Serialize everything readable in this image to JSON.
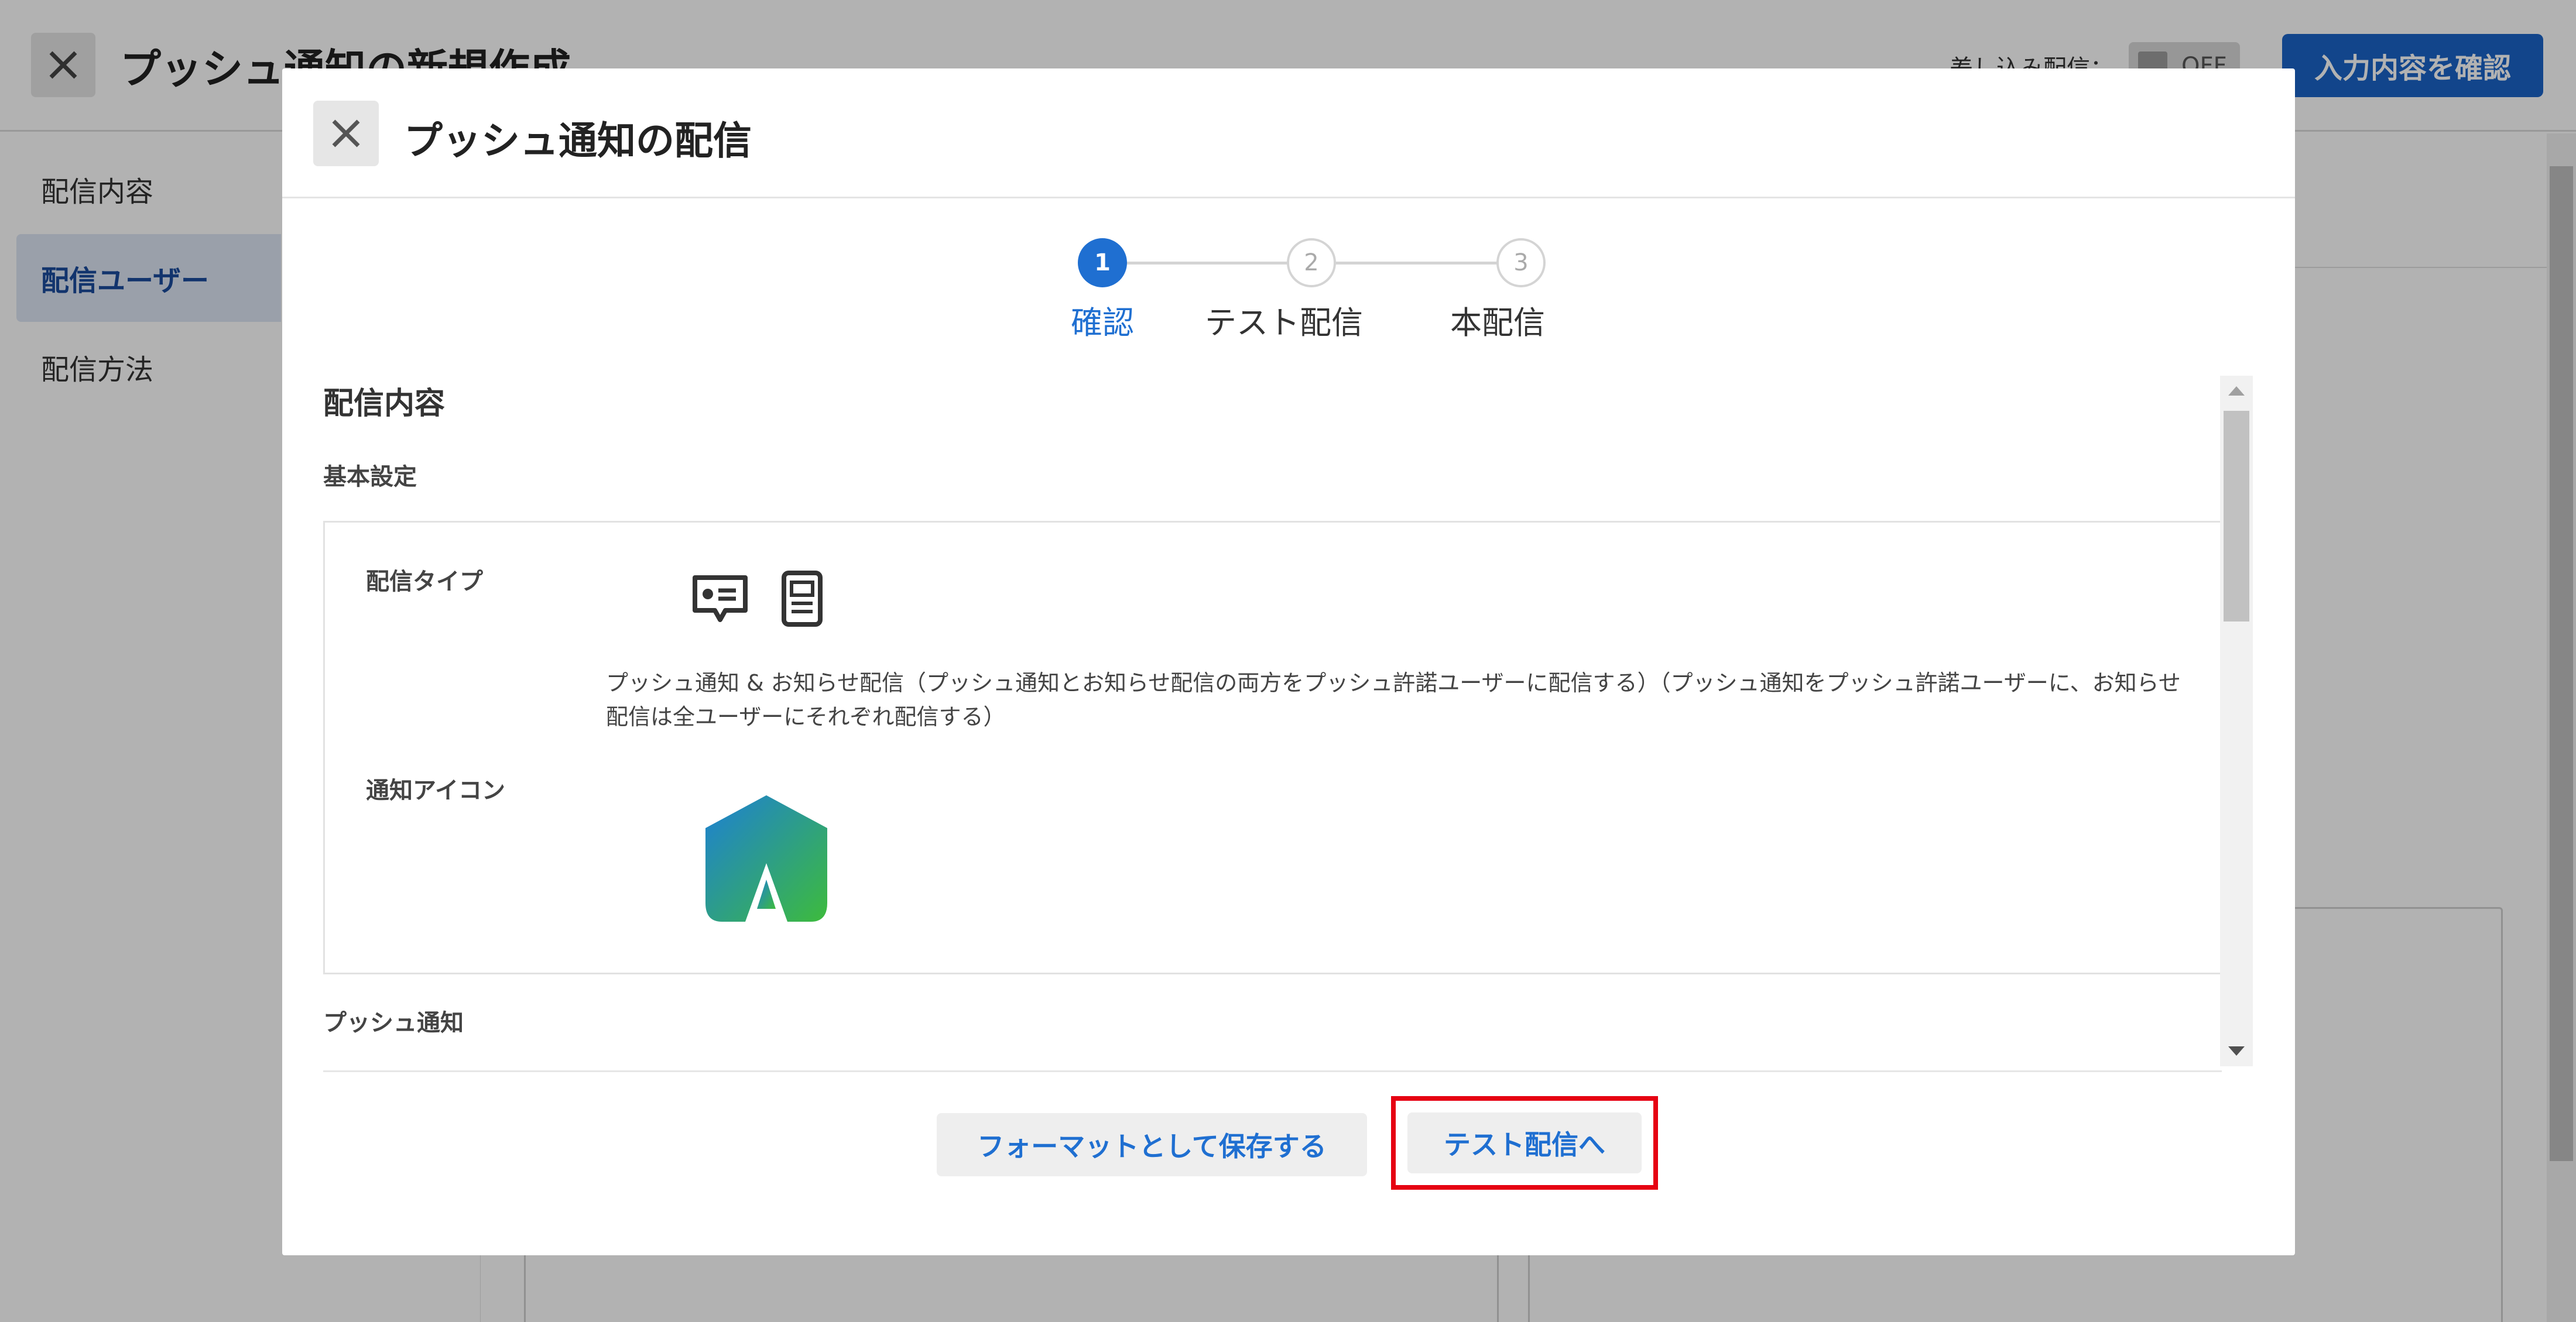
{
  "background": {
    "header": {
      "title": "プッシュ通知の新規作成",
      "merge_label": "差し込み配信：",
      "merge_toggle": "OFF",
      "confirm_button": "入力内容を確認"
    },
    "sidebar": {
      "items": [
        {
          "label": "配信内容",
          "active": false
        },
        {
          "label": "配信ユーザー",
          "active": true
        },
        {
          "label": "配信方法",
          "active": false
        }
      ]
    }
  },
  "modal": {
    "title": "プッシュ通知の配信",
    "steps": [
      {
        "number": "1",
        "label": "確認",
        "active": true
      },
      {
        "number": "2",
        "label": "テスト配信",
        "active": false
      },
      {
        "number": "3",
        "label": "本配信",
        "active": false
      }
    ],
    "content": {
      "title": "配信内容",
      "basic_section": "基本設定",
      "delivery_type_label": "配信タイプ",
      "delivery_type_icons": [
        "push-notification-icon",
        "notice-icon"
      ],
      "delivery_type_description": "プッシュ通知 & お知らせ配信（プッシュ通知とお知らせ配信の両方をプッシュ許諾ユーザーに配信する）（プッシュ通知をプッシュ許諾ユーザーに、お知らせ配信は全ユーザーにそれぞれ配信する）",
      "notification_icon_label": "通知アイコン",
      "push_section": "プッシュ通知"
    },
    "footer": {
      "save_format_button": "フォーマットとして保存する",
      "test_delivery_button": "テスト配信へ"
    }
  },
  "colors": {
    "primary": "#1f6fd1",
    "highlight": "#e60012",
    "logo_gradient_start": "#1d7fd6",
    "logo_gradient_end": "#3dbb3c"
  }
}
